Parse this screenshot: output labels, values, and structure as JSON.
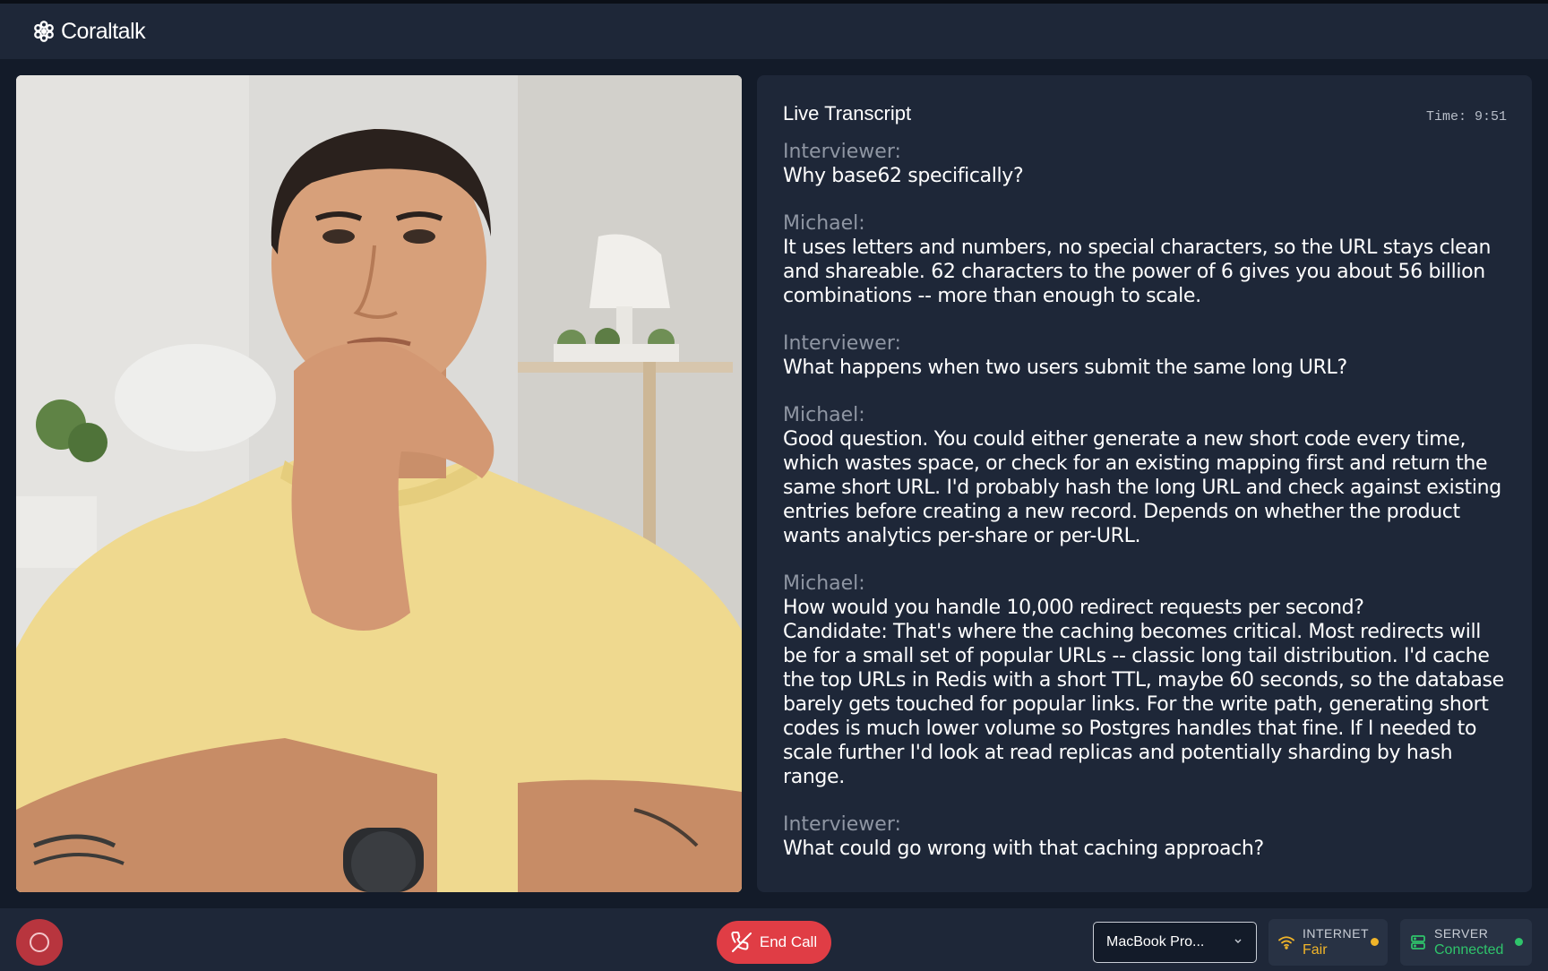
{
  "app": {
    "name": "Coraltalk"
  },
  "transcript": {
    "title": "Live Transcript",
    "time": "Time: 9:51",
    "entries": [
      {
        "speaker": "Interviewer:",
        "text": "Why base62 specifically?"
      },
      {
        "speaker": "Michael:",
        "text": "It uses letters and numbers, no special characters, so the URL stays clean and shareable. 62 characters to the power of 6 gives you about 56 billion combinations -- more than enough to scale."
      },
      {
        "speaker": "Interviewer:",
        "text": "What happens when two users submit the same long URL?"
      },
      {
        "speaker": "Michael:",
        "text": "Good question. You could either generate a new short code every time, which wastes space, or check for an existing mapping first and return the same short URL. I'd probably hash the long URL and check against existing entries before creating a new record. Depends on whether the product wants analytics per-share or per-URL."
      },
      {
        "speaker": "Michael:",
        "text": "How would you handle 10,000 redirect requests per second?\nCandidate: That's where the caching becomes critical. Most redirects will be for a small set of popular URLs -- classic long tail distribution. I'd cache the top URLs in Redis with a short TTL, maybe 60 seconds, so the database barely gets touched for popular links. For the write path, generating short codes is much lower volume so Postgres handles that fine. If I needed to scale further I'd look at read replicas and potentially sharding by hash range."
      },
      {
        "speaker": "Interviewer:",
        "text": "What could go wrong with that caching approach?"
      }
    ]
  },
  "controls": {
    "end_call_label": "End Call",
    "device_selected": "MacBook Pro...",
    "internet": {
      "label": "INTERNET",
      "value": "Fair",
      "color": "#f0b429"
    },
    "server": {
      "label": "SERVER",
      "value": "Connected",
      "color": "#2fc46b"
    }
  },
  "icons": {
    "logo": "coraltalk-logo-icon",
    "record": "record-icon",
    "end_call": "phone-hangup-icon",
    "dropdown": "chevron-down-icon",
    "internet": "wifi-icon",
    "server": "server-icon"
  },
  "colors": {
    "background": "#131b29",
    "panel": "#1e2738",
    "end_call": "#e03d45",
    "record": "#b8353e"
  }
}
